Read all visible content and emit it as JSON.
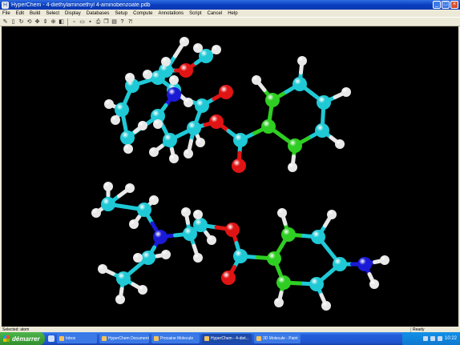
{
  "window": {
    "title": "HyperChem - 4-diethylaminoethyl 4-aminobenzoate.pdb",
    "app_icon": "H"
  },
  "menubar": {
    "items": [
      "File",
      "Edit",
      "Build",
      "Select",
      "Display",
      "Databases",
      "Setup",
      "Compute",
      "Annotations",
      "Script",
      "Cancel",
      "Help"
    ]
  },
  "toolbar": {
    "buttons": [
      "draw-tool",
      "select-tool",
      "rotate-out-of-plane-tool",
      "rotate-in-plane-tool",
      "translate-tool",
      "z-translate-tool",
      "zoom-tool",
      "z-clip-tool",
      "new-file",
      "open-file",
      "save-file",
      "print",
      "copy",
      "paste",
      "help",
      "context-help"
    ]
  },
  "statusbar": {
    "left": "Selected: atom",
    "right": "Ready"
  },
  "taskbar": {
    "start_label": "démarrer",
    "tasks": [
      {
        "label": "Inbox"
      },
      {
        "label": "HyperChem Document"
      },
      {
        "label": "Procaine Molecule"
      },
      {
        "label": "HyperChem - 4-diet..."
      },
      {
        "label": "3D Molecule - Paint"
      }
    ],
    "clock": "10:22"
  },
  "colors": {
    "carbon": "#1fc9d6",
    "carbon_aromatic": "#2fce23",
    "oxygen": "#e01414",
    "nitrogen": "#1a1ad6",
    "hydrogen": "#e8e8e8",
    "background": "#000000",
    "title_bar": "#0a3fbf"
  }
}
